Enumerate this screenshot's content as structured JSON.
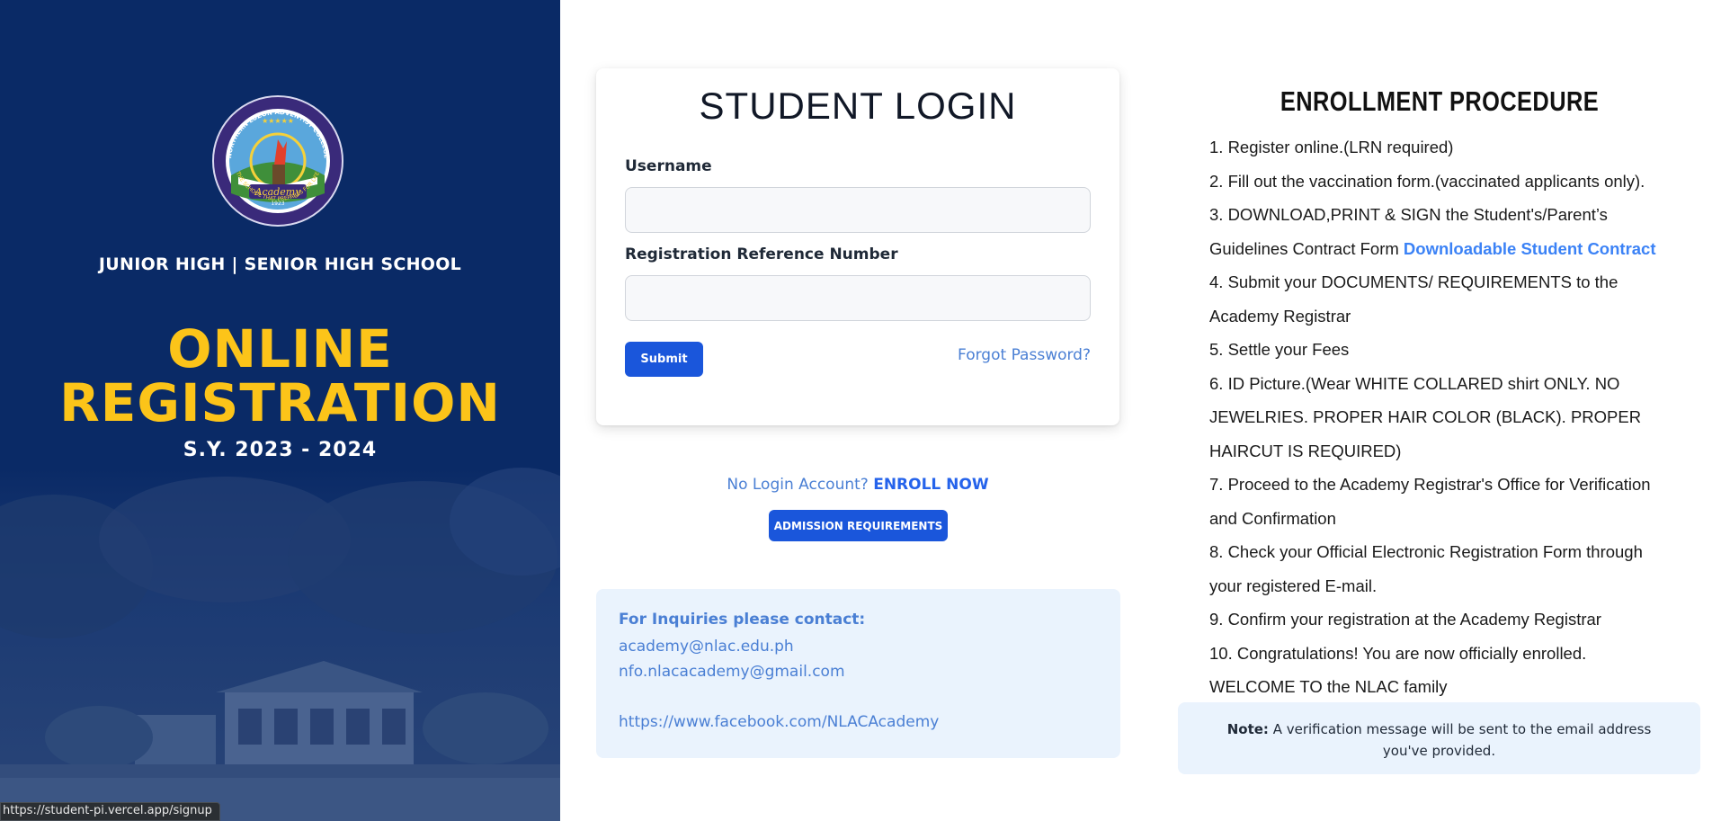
{
  "hero": {
    "subtitle": "JUNIOR HIGH | SENIOR HIGH SCHOOL",
    "title_line1": "ONLINE",
    "title_line2": "REGISTRATION",
    "school_year": "S.Y. 2023 - 2024",
    "logo_text_top": "NORTHERN LUZON ADVENTIST COLLEGE",
    "logo_banner": "Academy",
    "logo_year": "1923",
    "logo_text_bottom": "THE SCHOOL THAT PREPARES FOR LIFE"
  },
  "status_bar": {
    "url": "https://student-pi.vercel.app/signup"
  },
  "login": {
    "title": "STUDENT LOGIN",
    "username_label": "Username",
    "username_value": "",
    "reference_label": "Registration Reference Number",
    "reference_value": "",
    "submit_label": "Submit",
    "forgot_label": "Forgot Password?"
  },
  "signup": {
    "prompt": "No Login Account?",
    "enroll_label": "ENROLL NOW",
    "admission_label": "ADMISSION REQUIREMENTS"
  },
  "contact": {
    "title": "For Inquiries please contact:",
    "email1": "academy@nlac.edu.ph",
    "email2": "nfo.nlacacademy@gmail.com",
    "facebook": "https://www.facebook.com/NLACAcademy"
  },
  "procedure": {
    "title": "ENROLLMENT PROCEDURE",
    "steps": [
      "1. Register online.(LRN required)",
      "2. Fill out the vaccination form.(vaccinated applicants only).",
      "3. DOWNLOAD,PRINT & SIGN the Student's/Parent’s Guidelines Contract Form",
      "4. Submit your DOCUMENTS/ REQUIREMENTS to the Academy Registrar",
      "5. Settle your Fees",
      "6. ID Picture.(Wear WHITE COLLARED shirt ONLY. NO JEWELRIES. PROPER HAIR COLOR (BLACK). PROPER HAIRCUT IS REQUIRED)",
      "7. Proceed to the Academy Registrar's Office for Verification and Confirmation",
      "8. Check your Official Electronic Registration Form through your registered E-mail.",
      "9. Confirm your registration at the Academy Registrar",
      "10. Congratulations! You are now officially enrolled. WELCOME TO the NLAC family"
    ],
    "download_link": "Downloadable Student Contract"
  },
  "note": {
    "label": "Note:",
    "text": "A verification message will be sent to the email address you've provided."
  },
  "colors": {
    "hero_bg": "#0a2a66",
    "hero_title": "#fcc419",
    "primary_button": "#1a56db",
    "link": "#4a7fd4",
    "info_box": "#eaf3fd"
  }
}
